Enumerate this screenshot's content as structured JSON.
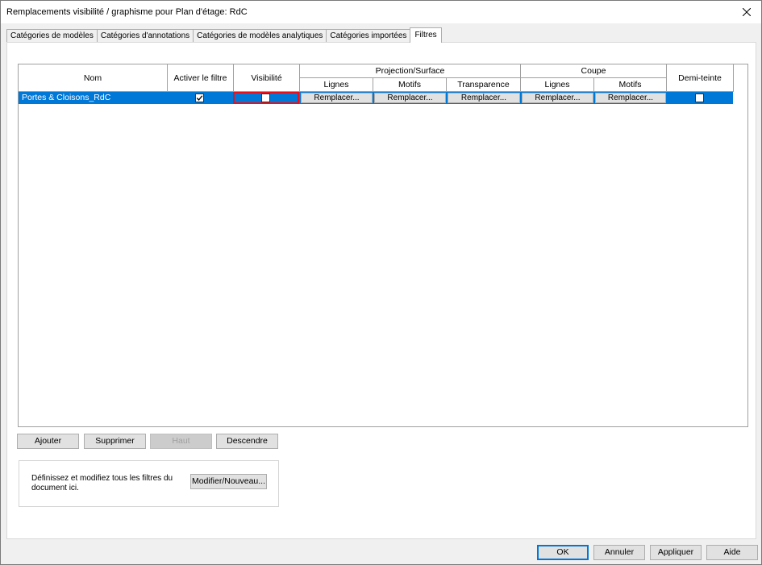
{
  "window": {
    "title": "Remplacements visibilité / graphisme pour Plan d'étage: RdC",
    "close_glyph": "✕"
  },
  "tabs": [
    {
      "label": "Catégories de modèles",
      "active": false
    },
    {
      "label": "Catégories d'annotations",
      "active": false
    },
    {
      "label": "Catégories de modèles analytiques",
      "active": false
    },
    {
      "label": "Catégories importées",
      "active": false
    },
    {
      "label": "Filtres",
      "active": true
    }
  ],
  "grid": {
    "headers": {
      "nom": "Nom",
      "activer": "Activer le filtre",
      "visibilite": "Visibilité",
      "projection": "Projection/Surface",
      "proj_lignes": "Lignes",
      "proj_motifs": "Motifs",
      "proj_transparence": "Transparence",
      "coupe": "Coupe",
      "coupe_lignes": "Lignes",
      "coupe_motifs": "Motifs",
      "demi_teinte": "Demi-teinte"
    },
    "rows": [
      {
        "name": "Portes & Cloisons_RdC",
        "activer_checked": true,
        "visibilite_checked": false,
        "proj_lignes": "Remplacer...",
        "proj_motifs": "Remplacer...",
        "proj_transparence": "Remplacer...",
        "coupe_lignes": "Remplacer...",
        "coupe_motifs": "Remplacer...",
        "demi_teinte_checked": false
      }
    ]
  },
  "row_buttons": {
    "ajouter": "Ajouter",
    "supprimer": "Supprimer",
    "haut": "Haut",
    "descendre": "Descendre"
  },
  "info": {
    "text": "Définissez et modifiez tous les filtres du document ici.",
    "button": "Modifier/Nouveau..."
  },
  "footer": {
    "ok": "OK",
    "annuler": "Annuler",
    "appliquer": "Appliquer",
    "aide": "Aide"
  },
  "colors": {
    "selection": "#0078d7",
    "highlight_outline": "#e8101a"
  }
}
